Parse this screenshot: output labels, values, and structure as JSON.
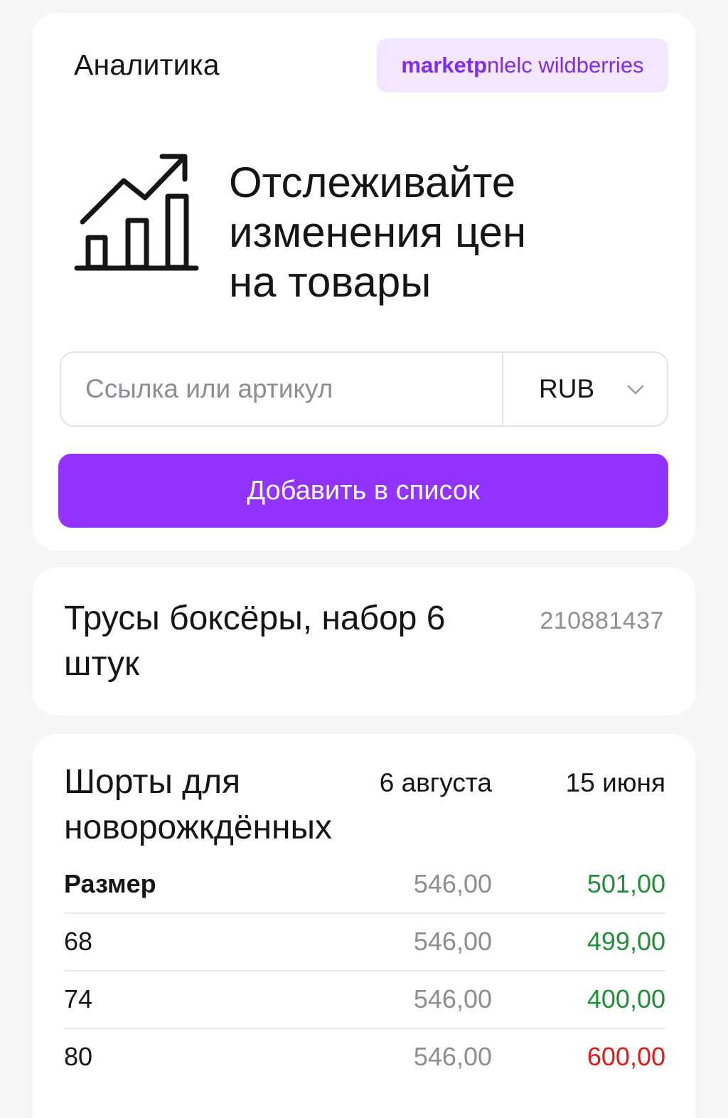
{
  "header": {
    "title": "Аналитика",
    "marketplace_badge_bold": "marketp",
    "marketplace_badge_rest": "nlelc wildberries",
    "badge_color": "#7d2cf0",
    "badge_bg": "#f3e7ff"
  },
  "hero": {
    "icon": "chart-growth-icon",
    "line1": "Отслеживайте",
    "line2": "изменения цен",
    "line3": "на товары"
  },
  "search": {
    "placeholder": "Ссылка или артикул",
    "value": "",
    "currency": "RUB",
    "currency_icon": "chevron-down-icon"
  },
  "add_button": {
    "label": "Добавить в список",
    "color": "#9233ff"
  },
  "product": {
    "title": "Трусы боксёры, набор 6 штук",
    "article": "210881437"
  },
  "price_table": {
    "title": "Шорты для новорожкдённых",
    "columns": [
      "6 августа",
      "15 июня"
    ],
    "rows": [
      {
        "size": "Размер",
        "old": "546,00",
        "new": "501,00",
        "status": "down"
      },
      {
        "size": "68",
        "old": "546,00",
        "new": "499,00",
        "status": "down"
      },
      {
        "size": "74",
        "old": "546,00",
        "new": "400,00",
        "status": "down"
      },
      {
        "size": "80",
        "old": "546,00",
        "new": "600,00",
        "status": "up"
      }
    ],
    "colors": {
      "down": "#1f8f3a",
      "up": "#e51919"
    }
  }
}
